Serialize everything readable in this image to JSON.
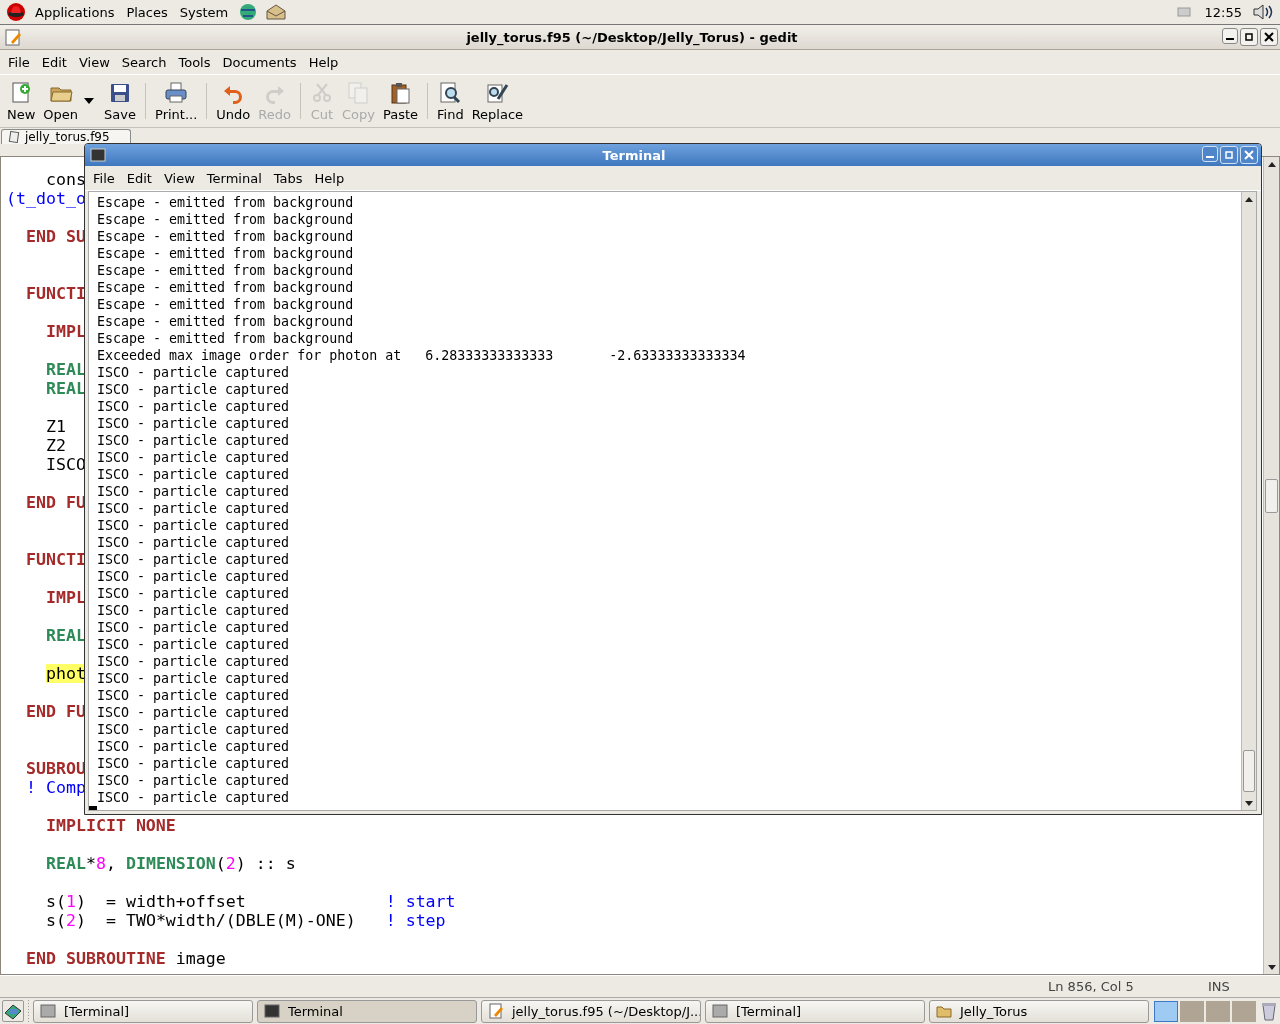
{
  "top_panel": {
    "menus": [
      "Applications",
      "Places",
      "System"
    ],
    "clock": "12:55"
  },
  "gedit": {
    "title": "jelly_torus.f95 (~/Desktop/Jelly_Torus) - gedit",
    "menu": [
      "File",
      "Edit",
      "View",
      "Search",
      "Tools",
      "Documents",
      "Help"
    ],
    "toolbar_groups": [
      [
        {
          "label": "New",
          "disabled": false,
          "dropdown": false
        },
        {
          "label": "Open",
          "disabled": false,
          "dropdown": true
        },
        {
          "label": "Save",
          "disabled": false,
          "dropdown": false
        }
      ],
      [
        {
          "label": "Print...",
          "disabled": false,
          "dropdown": false
        }
      ],
      [
        {
          "label": "Undo",
          "disabled": false,
          "dropdown": false
        },
        {
          "label": "Redo",
          "disabled": true,
          "dropdown": false
        }
      ],
      [
        {
          "label": "Cut",
          "disabled": true,
          "dropdown": false
        },
        {
          "label": "Copy",
          "disabled": true,
          "dropdown": false
        },
        {
          "label": "Paste",
          "disabled": false,
          "dropdown": false
        }
      ],
      [
        {
          "label": "Find",
          "disabled": false,
          "dropdown": false
        },
        {
          "label": "Replace",
          "disabled": false,
          "dropdown": false
        }
      ]
    ],
    "tab": {
      "label": "jelly_torus.f95",
      "selected": true
    },
    "sections": [
      {
        "blocks": [
          [
            [
              {
                "kind": "plain",
                "text": "    cons"
              }
            ],
            [
              {
                "kind": "comment",
                "text": "(t_dot_o"
              }
            ]
          ],
          [
            [
              {
                "kind": "keyword",
                "text": "  END SU"
              }
            ]
          ]
        ]
      },
      {
        "blocks": [
          [
            [
              {
                "kind": "keyword",
                "text": "  FUNCTI"
              }
            ]
          ],
          [
            [
              {
                "kind": "keyword",
                "text": "    IMPL"
              }
            ]
          ],
          [
            [
              {
                "kind": "type",
                "text": "    REAL"
              }
            ],
            [
              {
                "kind": "type",
                "text": "    REAL"
              }
            ]
          ],
          [
            [
              {
                "kind": "plain",
                "text": "    Z1"
              }
            ],
            [
              {
                "kind": "plain",
                "text": "    Z2"
              }
            ],
            [
              {
                "kind": "plain",
                "text": "    ISCO"
              }
            ]
          ],
          [
            [
              {
                "kind": "keyword",
                "text": "  END FU"
              }
            ]
          ]
        ]
      },
      {
        "blocks": [
          [
            [
              {
                "kind": "keyword",
                "text": "  FUNCTI"
              }
            ]
          ],
          [
            [
              {
                "kind": "keyword",
                "text": "    IMPL"
              }
            ]
          ],
          [
            [
              {
                "kind": "type",
                "text": "    REAL"
              }
            ]
          ],
          [
            [
              {
                "kind": "highlight",
                "text": "    phot"
              }
            ]
          ],
          [
            [
              {
                "kind": "keyword",
                "text": "  END FU"
              }
            ]
          ]
        ]
      },
      {
        "blocks": [
          [
            [
              {
                "kind": "keyword",
                "text": "  SUBROU"
              }
            ],
            [
              {
                "kind": "comment",
                "text": "  ! Comp"
              }
            ]
          ],
          [
            [
              {
                "kind": "keyword",
                "text": "    IMPLICIT NONE"
              }
            ]
          ],
          [
            [
              {
                "kind": "type",
                "text": "    REAL"
              },
              {
                "kind": "plain",
                "text": "*"
              },
              {
                "kind": "number",
                "text": "8"
              },
              {
                "kind": "plain",
                "text": ", "
              },
              {
                "kind": "type",
                "text": "DIMENSION"
              },
              {
                "kind": "plain",
                "text": "("
              },
              {
                "kind": "number",
                "text": "2"
              },
              {
                "kind": "plain",
                "text": ") :: s"
              }
            ]
          ],
          [
            [
              {
                "kind": "plain",
                "text": "    s("
              },
              {
                "kind": "number",
                "text": "1"
              },
              {
                "kind": "plain",
                "text": ")  = width+offset              "
              },
              {
                "kind": "comment",
                "text": "! start"
              }
            ],
            [
              {
                "kind": "plain",
                "text": "    s("
              },
              {
                "kind": "number",
                "text": "2"
              },
              {
                "kind": "plain",
                "text": ")  = TWO*width/(DBLE(M)-ONE)   "
              },
              {
                "kind": "comment",
                "text": "! step"
              }
            ]
          ],
          [
            [
              {
                "kind": "keyword",
                "text": "  END SUBROUTINE"
              },
              {
                "kind": "plain",
                "text": " image"
              }
            ]
          ]
        ]
      }
    ],
    "status": {
      "position": "Ln 856, Col 5",
      "mode": "INS"
    }
  },
  "terminal": {
    "title": "Terminal",
    "menu": [
      "File",
      "Edit",
      "View",
      "Terminal",
      "Tabs",
      "Help"
    ],
    "output": [
      "Escape - emitted from background",
      "Escape - emitted from background",
      "Escape - emitted from background",
      "Escape - emitted from background",
      "Escape - emitted from background",
      "Escape - emitted from background",
      "Escape - emitted from background",
      "Escape - emitted from background",
      "Escape - emitted from background",
      "Exceeded max image order for photon at   6.28333333333333       -2.63333333333334",
      "ISCO - particle captured",
      "ISCO - particle captured",
      "ISCO - particle captured",
      "ISCO - particle captured",
      "ISCO - particle captured",
      "ISCO - particle captured",
      "ISCO - particle captured",
      "ISCO - particle captured",
      "ISCO - particle captured",
      "ISCO - particle captured",
      "ISCO - particle captured",
      "ISCO - particle captured",
      "ISCO - particle captured",
      "ISCO - particle captured",
      "ISCO - particle captured",
      "ISCO - particle captured",
      "ISCO - particle captured",
      "ISCO - particle captured",
      "ISCO - particle captured",
      "ISCO - particle captured",
      "ISCO - particle captured",
      "ISCO - particle captured",
      "ISCO - particle captured",
      "ISCO - particle captured",
      "ISCO - particle captured",
      "ISCO - particle captured"
    ]
  },
  "taskbar": {
    "windows": [
      {
        "label": "[Terminal]",
        "selected": false
      },
      {
        "label": "Terminal",
        "selected": true
      },
      {
        "label": "jelly_torus.f95 (~/Desktop/J...",
        "selected": false
      },
      {
        "label": "[Terminal]",
        "selected": false
      },
      {
        "label": "Jelly_Torus",
        "selected": false
      }
    ],
    "workspaces": [
      {
        "selected": true
      },
      {
        "selected": false
      },
      {
        "selected": false
      },
      {
        "selected": false
      }
    ]
  }
}
